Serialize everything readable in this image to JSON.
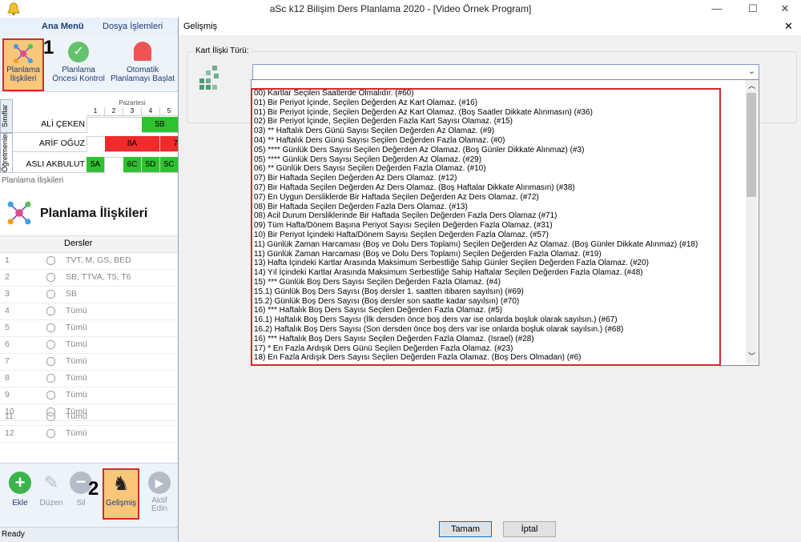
{
  "window": {
    "title": "aSc k12 Bilişim Ders Planlama 2020  - [Video Örnek Program]"
  },
  "ribbon": {
    "tabs": [
      "Ana Menü",
      "Dosya İşlemleri"
    ],
    "buttons": [
      {
        "label": "Planlama\nİlişkileri"
      },
      {
        "label": "Planlama\nÖncesi Kontrol"
      },
      {
        "label": "Otomatik\nPlanlamayı Başlat"
      }
    ],
    "marker": "1"
  },
  "grid": {
    "side_tabs": [
      "Sınıflar",
      "Öğretmenler"
    ],
    "day": "Pazartesi",
    "periods": [
      "1",
      "2",
      "3",
      "4",
      "5"
    ],
    "rows": [
      {
        "name": "ALİ ÇEKEN",
        "cells": [
          "",
          "",
          "",
          "5B",
          ""
        ]
      },
      {
        "name": "ARİF OĞUZ",
        "cells": [
          "",
          "8A",
          "",
          "",
          "7"
        ]
      },
      {
        "name": "ASLI AKBULUT",
        "cells": [
          "5A",
          "",
          "6C",
          "5D",
          "5C"
        ]
      }
    ]
  },
  "panel": {
    "caption": "Planlama İlişkileri",
    "title": "Planlama İlişkileri",
    "column_header": "Dersler",
    "rows": [
      {
        "num": "1",
        "text": "TVT, M, GS, BED"
      },
      {
        "num": "2",
        "text": "SB, TTVA, T5, T6"
      },
      {
        "num": "3",
        "text": "SB"
      },
      {
        "num": "4",
        "text": "Tümü"
      },
      {
        "num": "5",
        "text": "Tümü"
      },
      {
        "num": "6",
        "text": "Tümü"
      },
      {
        "num": "7",
        "text": "Tümü"
      },
      {
        "num": "8",
        "text": "Tümü"
      },
      {
        "num": "9",
        "text": "Tümü"
      },
      {
        "num": "10",
        "text": "Tümü"
      },
      {
        "num": "11",
        "text": "Tümü"
      },
      {
        "num": "12",
        "text": "Tümü"
      }
    ]
  },
  "toolbar": {
    "add": "Ekle",
    "edit": "Düzen",
    "delete": "Sil",
    "advanced": "Gelişmiş",
    "active": "Aktif\nEdin",
    "marker": "2"
  },
  "status": "Ready",
  "dialog": {
    "title": "Gelişmiş",
    "close": "✕",
    "group_label": "Kart İlişki Türü:",
    "options": [
      "00) Kartlar Seçilen Saatlerde Olmalıdır. (#60)",
      "01) Bir Periyot İçinde, Seçilen Değerden Az Kart Olamaz. (#16)",
      "01) Bir Periyot İçinde, Seçilen Değerden Az Kart Olamaz. (Boş Saatler Dikkate Alınmasın) (#36)",
      "02) Bir Periyot İçinde, Seçilen Değerden Fazla Kart Sayısı Olamaz. (#15)",
      "03) ** Haftalık Ders Günü Sayısı Seçilen Değerden Az Olamaz. (#9)",
      "04) ** Haftalık Ders Günü Sayısı Seçilen Değerden Fazla Olamaz. (#0)",
      "05) **** Günlük Ders Sayısı Seçilen Değerden Az Olamaz. (Boş Günler Dikkate Alınmaz) (#3)",
      "05) **** Günlük Ders Sayısı Seçilen Değerden Az Olamaz. (#29)",
      "06) ** Günlük Ders Sayısı Seçilen Değerden Fazla Olamaz. (#10)",
      "07) Bir Haftada Seçilen Değerden Az Ders Olamaz. (#12)",
      "07) Bir Haftada Seçilen Değerden Az Ders Olamaz. (Boş Haftalar Dikkate Alınmasın) (#38)",
      "07) En Uygun Dersliklerde Bir Haftada Seçilen Değerden Az Ders Olamaz. (#72)",
      "08) Bir Haftada Seçilen Değerden Fazla Ders Olamaz. (#13)",
      "08) Acil Durum Dersliklerinde Bir Haftada Seçilen Değerden Fazla Ders Olamaz (#71)",
      "09) Tüm Hafta/Dönem Başına Periyot Sayısı Seçilen Değerden Fazla Olamaz. (#31)",
      "10) Bir Periyot İçindeki Hafta/Dönem Sayısı Seçilen Değerden Fazla Olamaz. (#57)",
      "11) Günlük Zaman Harcaması (Boş ve Dolu Ders Toplamı) Seçilen Değerden Az Olamaz.  (Boş Günler Dikkate Alınmaz) (#18)",
      "11) Günlük Zaman Harcaması (Boş ve Dolu Ders Toplamı) Seçilen Değerden Fazla Olamaz.  (#19)",
      "13) Hafta İçindeki Kartlar Arasında Maksimum Serbestliğe Sahip Günler Seçilen Değerden Fazla Olamaz. (#20)",
      "14) Yıl İçindeki Kartlar Arasında Maksimum Serbestliğe Sahip Haftalar Seçilen Değerden Fazla Olamaz. (#48)",
      "15) *** Günlük Boş Ders Sayısı Seçilen Değerden Fazla Olamaz. (#4)",
      "15.1) Günlük Boş Ders Sayısı (Boş dersler 1. saatten itibaren sayılsın) (#69)",
      "15.2) Günlük Boş Ders Sayısı (Boş dersler son saatte kadar sayılsın) (#70)",
      "16) *** Haftalık Boş Ders Sayısı Seçilen Değerden Fazla Olamaz. (#5)",
      "16.1) Haftalık Boş Ders Sayısı (İlk dersden önce boş ders var ise onlarda boşluk olarak sayılsın.) (#67)",
      "16.2) Haftalık Boş Ders Sayısı (Son dersden önce boş ders var ise onlarda boşluk olarak sayılsın.) (#68)",
      "16) *** Haftalık Boş Ders Sayısı Seçilen Değerden Fazla Olamaz. (Israel) (#28)",
      "17) * En Fazla Ardışık Ders Günü Seçilen Değerden Fazla Olamaz. (#23)",
      "18) En Fazla Ardışık Ders Sayısı Seçilen Değerden Fazla Olamaz. (Boş Ders Olmadan) (#6)"
    ],
    "ok": "Tamam",
    "cancel": "İptal"
  },
  "colors": {
    "accent": "#1d3d75",
    "highlight": "#d7272e",
    "green": "#2fc12f",
    "red": "#ef2b2b"
  }
}
